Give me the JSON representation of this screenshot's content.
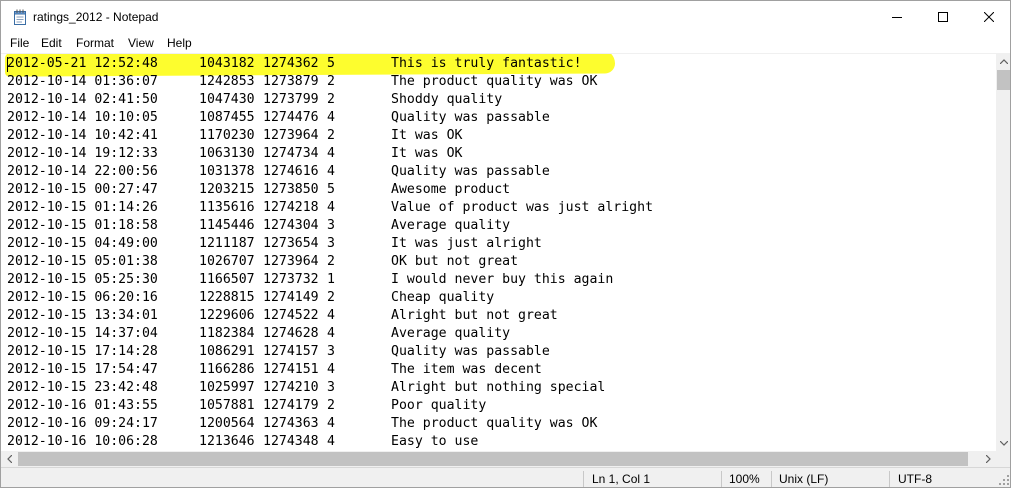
{
  "window": {
    "title": "ratings_2012 - Notepad"
  },
  "title_controls": {
    "minimize": "minimize-icon",
    "maximize": "maximize-icon",
    "close": "close-icon"
  },
  "menu": [
    "File",
    "Edit",
    "Format",
    "View",
    "Help"
  ],
  "lines": [
    {
      "ts": "2012-05-21 12:52:48",
      "uid": "1043182",
      "pid": "1274362",
      "rating": "5",
      "text": "This is truly fantastic!"
    },
    {
      "ts": "2012-10-14 01:36:07",
      "uid": "1242853",
      "pid": "1273879",
      "rating": "2",
      "text": "The product quality was OK"
    },
    {
      "ts": "2012-10-14 02:41:50",
      "uid": "1047430",
      "pid": "1273799",
      "rating": "2",
      "text": "Shoddy quality"
    },
    {
      "ts": "2012-10-14 10:10:05",
      "uid": "1087455",
      "pid": "1274476",
      "rating": "4",
      "text": "Quality was passable"
    },
    {
      "ts": "2012-10-14 10:42:41",
      "uid": "1170230",
      "pid": "1273964",
      "rating": "2",
      "text": "It was OK"
    },
    {
      "ts": "2012-10-14 19:12:33",
      "uid": "1063130",
      "pid": "1274734",
      "rating": "4",
      "text": "It was OK"
    },
    {
      "ts": "2012-10-14 22:00:56",
      "uid": "1031378",
      "pid": "1274616",
      "rating": "4",
      "text": "Quality was passable"
    },
    {
      "ts": "2012-10-15 00:27:47",
      "uid": "1203215",
      "pid": "1273850",
      "rating": "5",
      "text": "Awesome product"
    },
    {
      "ts": "2012-10-15 01:14:26",
      "uid": "1135616",
      "pid": "1274218",
      "rating": "4",
      "text": "Value of product was just alright"
    },
    {
      "ts": "2012-10-15 01:18:58",
      "uid": "1145446",
      "pid": "1274304",
      "rating": "3",
      "text": "Average quality"
    },
    {
      "ts": "2012-10-15 04:49:00",
      "uid": "1211187",
      "pid": "1273654",
      "rating": "3",
      "text": "It was just alright"
    },
    {
      "ts": "2012-10-15 05:01:38",
      "uid": "1026707",
      "pid": "1273964",
      "rating": "2",
      "text": "OK but not great"
    },
    {
      "ts": "2012-10-15 05:25:30",
      "uid": "1166507",
      "pid": "1273732",
      "rating": "1",
      "text": "I would never buy this again"
    },
    {
      "ts": "2012-10-15 06:20:16",
      "uid": "1228815",
      "pid": "1274149",
      "rating": "2",
      "text": "Cheap quality"
    },
    {
      "ts": "2012-10-15 13:34:01",
      "uid": "1229606",
      "pid": "1274522",
      "rating": "4",
      "text": "Alright but not great"
    },
    {
      "ts": "2012-10-15 14:37:04",
      "uid": "1182384",
      "pid": "1274628",
      "rating": "4",
      "text": "Average quality"
    },
    {
      "ts": "2012-10-15 17:14:28",
      "uid": "1086291",
      "pid": "1274157",
      "rating": "3",
      "text": "Quality was passable"
    },
    {
      "ts": "2012-10-15 17:54:47",
      "uid": "1166286",
      "pid": "1274151",
      "rating": "4",
      "text": "The item was decent"
    },
    {
      "ts": "2012-10-15 23:42:48",
      "uid": "1025997",
      "pid": "1274210",
      "rating": "3",
      "text": "Alright but nothing special"
    },
    {
      "ts": "2012-10-16 01:43:55",
      "uid": "1057881",
      "pid": "1274179",
      "rating": "2",
      "text": "Poor quality"
    },
    {
      "ts": "2012-10-16 09:24:17",
      "uid": "1200564",
      "pid": "1274363",
      "rating": "4",
      "text": "The product quality was OK"
    },
    {
      "ts": "2012-10-16 10:06:28",
      "uid": "1213646",
      "pid": "1274348",
      "rating": "4",
      "text": "Easy to use"
    }
  ],
  "highlighted_line": 0,
  "highlight_color": "#fdfd2e",
  "statusbar": {
    "position": "Ln 1, Col 1",
    "zoom": "100%",
    "line_endings": "Unix (LF)",
    "encoding": "UTF-8"
  }
}
